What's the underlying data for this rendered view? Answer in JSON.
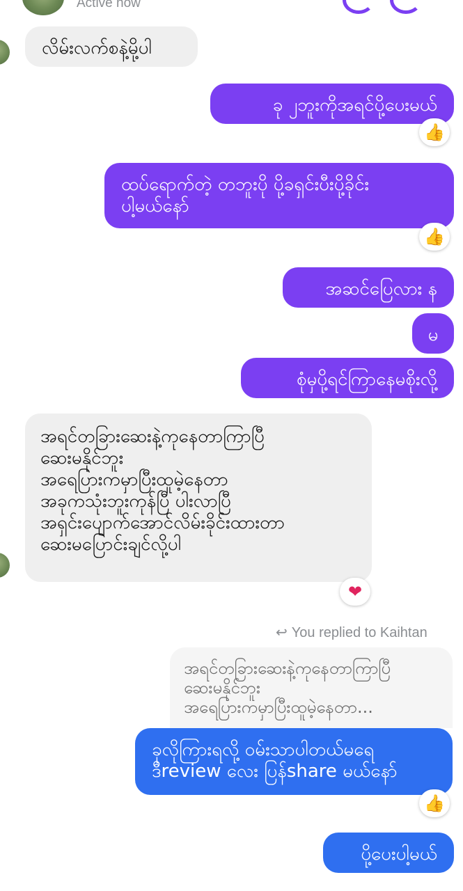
{
  "header": {
    "status": "Active now"
  },
  "messages": [
    {
      "id": "m1",
      "direction": "in",
      "text": "လိမ်းလက်စနဲ့မို့ပါ"
    },
    {
      "id": "m2",
      "direction": "out",
      "text": "ခု ၂ဘူးကိုအရင်ပို့ပေးမယ်",
      "reaction": "thumbs-up-icon"
    },
    {
      "id": "m3",
      "direction": "out",
      "text": "ထပ်ရောက်တဲ့ တဘူးပို ပို့ခရှင်းပီးပို့ခိုင်း\nပါ့မယ်နော်",
      "reaction": "thumbs-up-icon"
    },
    {
      "id": "m4",
      "direction": "out",
      "text": "အဆင်ပြေလား န"
    },
    {
      "id": "m5",
      "direction": "out",
      "text": "မ"
    },
    {
      "id": "m6",
      "direction": "out",
      "text": "စုံမှပို့ရင်ကြာနေမစိုးလို့"
    },
    {
      "id": "m7",
      "direction": "in",
      "text": "အရင်တခြားဆေးနဲ့ကုနေတာကြာပြီ\nဆေးမနိုင်ဘူး\nအရေပြားကမှာပြီးထူမဲ့နေတာ\nအခုကသုံးဘူးကုန်ပြီ ပါးလာပြီ\nအရှင်းပျောက်အောင်လိမ်းခိုင်းထားတာ\nဆေးမပြောင်းချင်လို့ပါ",
      "reaction": "heart-icon"
    },
    {
      "id": "m8",
      "direction": "out",
      "reply_label": "You replied to Kaihtan",
      "quote": "အရင်တခြားဆေးနဲ့ကုနေတာကြာပြီ\nဆေးမနိုင်ဘူး\nအရေပြားကမှာပြီးထူမဲ့နေတာ...",
      "text": "ခုလိုကြားရလို့ ဝမ်းသာပါတယ်မရေ\nဒီreview လေး ပြန်share မယ်နော်",
      "reaction": "thumbs-up-icon"
    },
    {
      "id": "m9",
      "direction": "out",
      "text": "ပို့ပေးပါ့မယ်"
    }
  ],
  "colors": {
    "outgoing": "#7b3ff2",
    "outgoing_reply": "#2f6ff0",
    "incoming": "#efefef"
  }
}
